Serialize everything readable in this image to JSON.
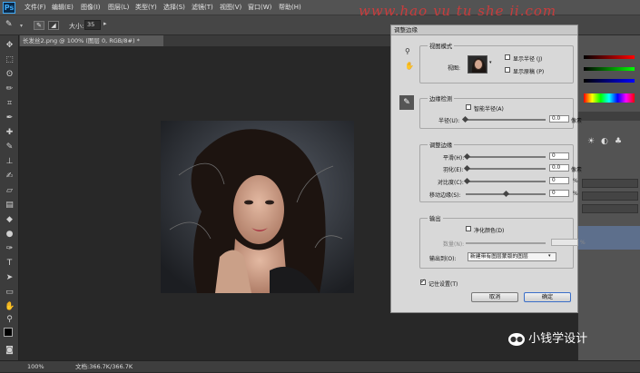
{
  "menubar": {
    "logo": "Ps",
    "items": [
      "文件(F)",
      "编辑(E)",
      "图像(I)",
      "图层(L)",
      "类型(Y)",
      "选择(S)",
      "滤镜(T)",
      "视图(V)",
      "窗口(W)",
      "帮助(H)"
    ]
  },
  "optbar": {
    "size_label": "大小:",
    "size_value": "35"
  },
  "document": {
    "tab_label": "长发丝2.png @ 100% (图层 0, RGB/8#) *"
  },
  "statusbar": {
    "zoom": "100%",
    "doc_info": "文档:366.7K/366.7K"
  },
  "watermark": "www.hao yu tu she ji.com",
  "wechat_label": "小钱学设计",
  "dialog": {
    "title": "调整边缘",
    "view_mode": {
      "legend": "视图模式",
      "view_label": "视图:",
      "show_radius": "显示半径 (J)",
      "show_original": "显示原稿 (P)"
    },
    "edge_detection": {
      "legend": "边缘检测",
      "smart_radius": "智能半径(A)",
      "radius_label": "半径(U):",
      "radius_value": "0.0",
      "radius_unit": "像素"
    },
    "adjust_edge": {
      "legend": "调整边缘",
      "smooth_label": "平滑(H):",
      "smooth_value": "0",
      "feather_label": "羽化(E):",
      "feather_value": "0.0",
      "feather_unit": "像素",
      "contrast_label": "对比度(C):",
      "contrast_value": "0",
      "contrast_unit": "%",
      "shift_label": "移动边缘(S):",
      "shift_value": "0",
      "shift_unit": "%"
    },
    "output": {
      "legend": "输出",
      "decontaminate": "净化颜色(D)",
      "amount_label": "数量(N):",
      "amount_unit": "%",
      "output_to_label": "输出到(O):",
      "output_to_value": "新建带有图层蒙版的图层"
    },
    "remember": "记住设置(T)",
    "cancel": "取消",
    "ok": "确定"
  }
}
